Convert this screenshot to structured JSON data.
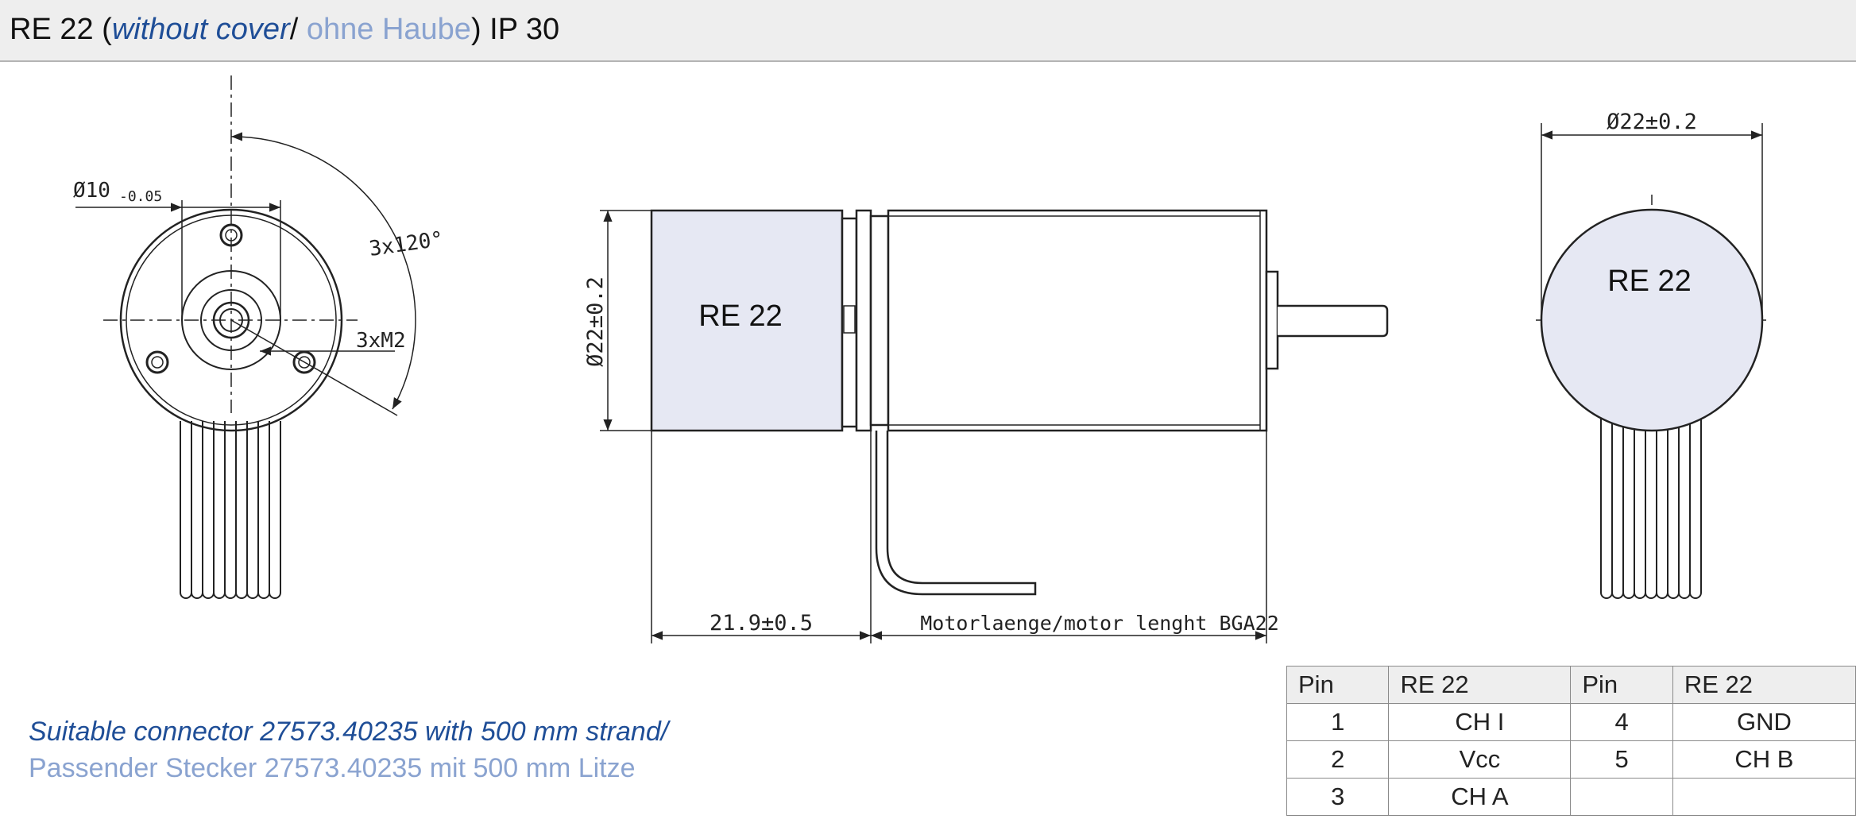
{
  "header": {
    "model": "RE 22",
    "open_paren": " (",
    "without_cover_en": "without cover",
    "slash": "/ ",
    "without_cover_de": "ohne Haube",
    "close_paren": ")",
    "protection": " IP 30"
  },
  "drawing": {
    "front_view": {
      "diameter_label": "Ø10",
      "tolerance": "-0.05",
      "angle_label": "3x120°",
      "screw_label": "3xM2"
    },
    "side_view": {
      "diameter_label": "Ø22±0.2",
      "encoder_label": "RE 22",
      "encoder_length_label": "21.9±0.5",
      "motor_length_label": "Motorlaenge/motor lenght BGA22"
    },
    "end_view": {
      "diameter_label": "Ø22±0.2",
      "encoder_label": "RE 22"
    }
  },
  "note": {
    "en": "Suitable connector 27573.40235 with 500 mm strand/",
    "de": "Passender Stecker 27573.40235 mit 500 mm Litze"
  },
  "pin_table": {
    "headers": [
      "Pin",
      "RE 22",
      "Pin",
      "RE 22"
    ],
    "rows": [
      [
        "1",
        "CH I",
        "4",
        "GND"
      ],
      [
        "2",
        "Vcc",
        "5",
        "CH B"
      ],
      [
        "3",
        "CH A",
        "",
        ""
      ]
    ]
  },
  "colors": {
    "encoder_fill": "#e6e8f3",
    "accent_blue": "#1f4e97",
    "light_blue": "#8aa3d0"
  }
}
